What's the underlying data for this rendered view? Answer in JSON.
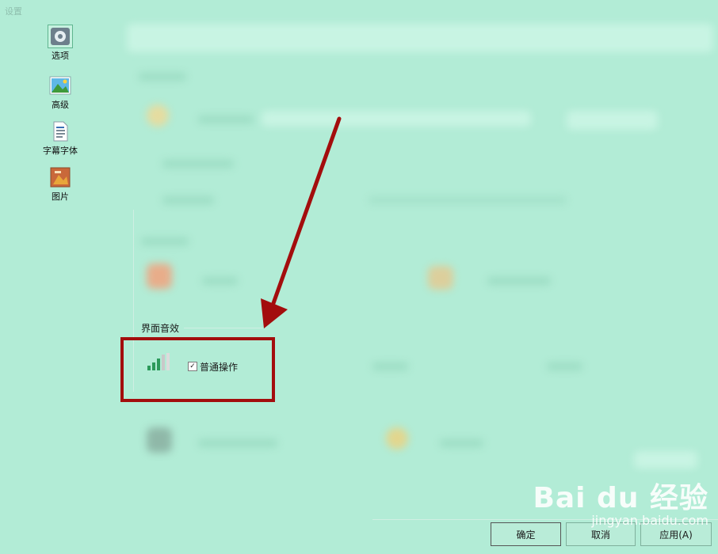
{
  "window": {
    "title": "设置"
  },
  "sidebar": {
    "items": [
      {
        "label": "选项",
        "icon": "gear-icon",
        "selected": true
      },
      {
        "label": "高级",
        "icon": "landscape-picture-icon",
        "selected": false
      },
      {
        "label": "字幕字体",
        "icon": "document-text-icon",
        "selected": false
      },
      {
        "label": "图片",
        "icon": "photo-gallery-icon",
        "selected": false
      }
    ]
  },
  "sound_group": {
    "title": "界面音效",
    "checkbox_label": "普通操作",
    "checked": true,
    "icon": "volume-signal-icon"
  },
  "buttons": {
    "ok": "确定",
    "cancel": "取消",
    "apply": "应用(A)"
  },
  "watermark": {
    "brand": "Bai du 经验",
    "url": "jingyan.baidu.com"
  },
  "colors": {
    "background": "#b2ecd6",
    "highlight": "#a30d0d",
    "arrow": "#a30d0d"
  }
}
